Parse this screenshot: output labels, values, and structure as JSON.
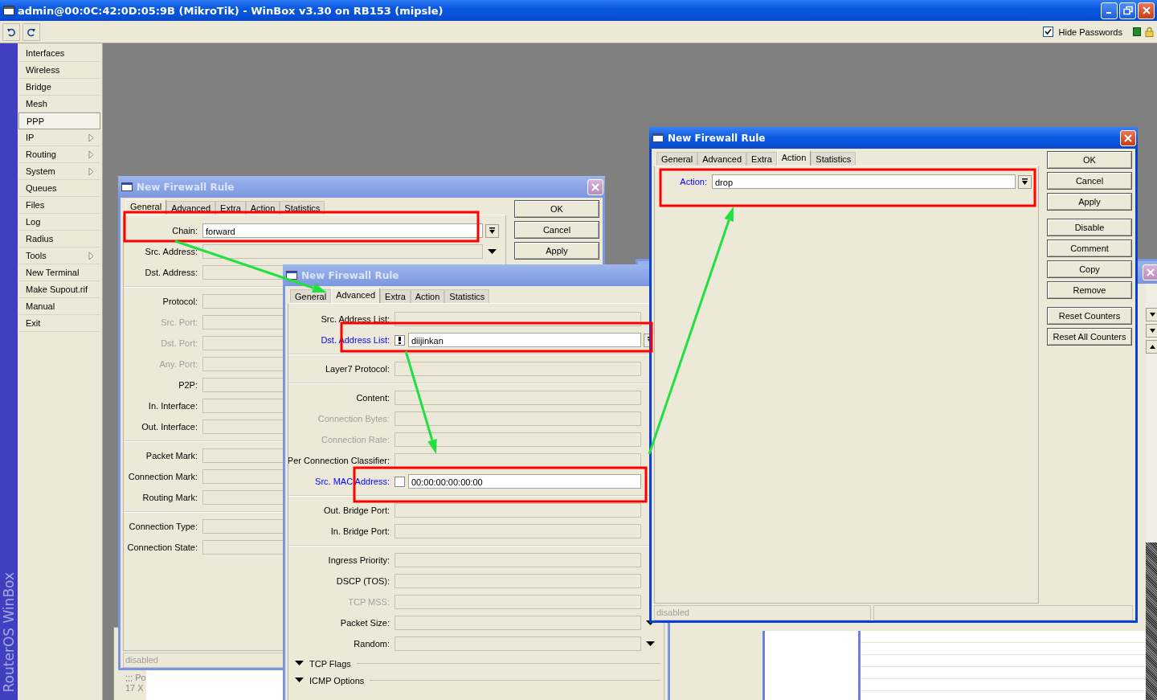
{
  "window": {
    "title": "admin@00:0C:42:0D:05:9B (MikroTik) - WinBox v3.30 on RB153 (mipsle)"
  },
  "toolbar": {
    "hide_passwords": {
      "label": "Hide Passwords",
      "checked": true
    }
  },
  "brand": "RouterOS WinBox",
  "sidebar": {
    "items": [
      {
        "label": "Interfaces",
        "selected": false,
        "submenu": false
      },
      {
        "label": "Wireless",
        "selected": false,
        "submenu": false
      },
      {
        "label": "Bridge",
        "selected": false,
        "submenu": false
      },
      {
        "label": "Mesh",
        "selected": false,
        "submenu": false
      },
      {
        "label": "PPP",
        "selected": true,
        "submenu": false
      },
      {
        "label": "IP",
        "selected": false,
        "submenu": true
      },
      {
        "label": "Routing",
        "selected": false,
        "submenu": true
      },
      {
        "label": "System",
        "selected": false,
        "submenu": true
      },
      {
        "label": "Queues",
        "selected": false,
        "submenu": false
      },
      {
        "label": "Files",
        "selected": false,
        "submenu": false
      },
      {
        "label": "Log",
        "selected": false,
        "submenu": false
      },
      {
        "label": "Radius",
        "selected": false,
        "submenu": false
      },
      {
        "label": "Tools",
        "selected": false,
        "submenu": true
      },
      {
        "label": "New Terminal",
        "selected": false,
        "submenu": false
      },
      {
        "label": "Make Supout.rif",
        "selected": false,
        "submenu": false
      },
      {
        "label": "Manual",
        "selected": false,
        "submenu": false
      },
      {
        "label": "Exit",
        "selected": false,
        "submenu": false
      }
    ]
  },
  "background_list": {
    "rows": [
      ";;; Po",
      "17 X"
    ]
  },
  "dialogs": [
    {
      "title": "New Firewall Rule",
      "active": false,
      "tabs": [
        {
          "label": "General",
          "selected": true
        },
        {
          "label": "Advanced",
          "selected": false
        },
        {
          "label": "Extra",
          "selected": false
        },
        {
          "label": "Action",
          "selected": false
        },
        {
          "label": "Statistics",
          "selected": false
        }
      ],
      "groups": [
        [
          {
            "label": "Chain:",
            "value": "forward",
            "dropdown": {
              "kind": "button"
            },
            "disabled": false,
            "emphasized": false
          },
          {
            "label": "Src. Address:",
            "dropdown": {
              "kind": "arrow"
            },
            "disabled": false,
            "emphasized": false
          },
          {
            "label": "Dst. Address:",
            "disabled": false,
            "emphasized": false
          }
        ],
        [
          {
            "label": "Protocol:",
            "disabled": false,
            "emphasized": false
          },
          {
            "label": "Src. Port:",
            "disabled": true,
            "emphasized": false
          },
          {
            "label": "Dst. Port:",
            "disabled": true,
            "emphasized": false
          },
          {
            "label": "Any. Port:",
            "disabled": true,
            "emphasized": false
          },
          {
            "label": "P2P:",
            "disabled": false,
            "emphasized": false
          },
          {
            "label": "In. Interface:",
            "disabled": false,
            "emphasized": false
          },
          {
            "label": "Out. Interface:",
            "disabled": false,
            "emphasized": false
          }
        ],
        [
          {
            "label": "Packet Mark:",
            "disabled": false,
            "emphasized": false
          },
          {
            "label": "Connection Mark:",
            "disabled": false,
            "emphasized": false
          },
          {
            "label": "Routing Mark:",
            "disabled": false,
            "emphasized": false
          }
        ],
        [
          {
            "label": "Connection Type:",
            "disabled": false,
            "emphasized": false
          },
          {
            "label": "Connection State:",
            "disabled": false,
            "emphasized": false
          }
        ]
      ],
      "button_groups": [
        [
          "OK",
          "Cancel",
          "Apply"
        ]
      ],
      "status": "disabled"
    },
    {
      "title": "New Firewall Rule",
      "active": false,
      "tabs": [
        {
          "label": "General",
          "selected": false
        },
        {
          "label": "Advanced",
          "selected": true
        },
        {
          "label": "Extra",
          "selected": false
        },
        {
          "label": "Action",
          "selected": false
        },
        {
          "label": "Statistics",
          "selected": false
        }
      ],
      "groups": [
        [
          {
            "label": "Src. Address List:",
            "disabled": false,
            "emphasized": false
          },
          {
            "label": "Dst. Address List:",
            "kind": "negatable",
            "negated": true,
            "value": "diijinkan",
            "dropdown": {
              "kind": "button"
            },
            "disabled": false,
            "emphasized": true
          }
        ],
        [
          {
            "label": "Layer7 Protocol:",
            "disabled": false,
            "emphasized": false
          }
        ],
        [
          {
            "label": "Content:",
            "disabled": false,
            "emphasized": false
          },
          {
            "label": "Connection Bytes:",
            "disabled": true,
            "emphasized": false
          },
          {
            "label": "Connection Rate:",
            "disabled": true,
            "emphasized": false
          },
          {
            "label": "Per Connection Classifier:",
            "disabled": false,
            "emphasized": false
          },
          {
            "label": "Src. MAC Address:",
            "kind": "negatable",
            "negated": false,
            "value": "00:00:00:00:00:00",
            "disabled": false,
            "emphasized": true
          }
        ],
        [
          {
            "label": "Out. Bridge Port:",
            "disabled": false,
            "emphasized": false
          },
          {
            "label": "In. Bridge Port:",
            "disabled": false,
            "emphasized": false
          }
        ],
        [
          {
            "label": "Ingress Priority:",
            "disabled": false,
            "emphasized": false
          },
          {
            "label": "DSCP (TOS):",
            "disabled": false,
            "emphasized": false
          },
          {
            "label": "TCP MSS:",
            "disabled": true,
            "emphasized": false
          },
          {
            "label": "Packet Size:",
            "dropdown": {
              "kind": "arrow"
            },
            "disabled": false,
            "emphasized": false
          },
          {
            "label": "Random:",
            "dropdown": {
              "kind": "arrow"
            },
            "disabled": false,
            "emphasized": false
          }
        ]
      ],
      "sections": [
        {
          "label": "TCP Flags"
        },
        {
          "label": "ICMP Options"
        }
      ]
    },
    {
      "title": "New Firewall Rule",
      "active": true,
      "tabs": [
        {
          "label": "General",
          "selected": false
        },
        {
          "label": "Advanced",
          "selected": false
        },
        {
          "label": "Extra",
          "selected": false
        },
        {
          "label": "Action",
          "selected": true
        },
        {
          "label": "Statistics",
          "selected": false
        }
      ],
      "groups": [
        [
          {
            "label": "Action:",
            "value": "drop",
            "dropdown": {
              "kind": "button"
            },
            "disabled": false,
            "emphasized": true
          }
        ]
      ],
      "button_groups": [
        [
          "OK",
          "Cancel",
          "Apply"
        ],
        [
          "Disable",
          "Comment",
          "Copy",
          "Remove"
        ],
        [
          "Reset Counters",
          "Reset All Counters"
        ]
      ],
      "status": "disabled"
    }
  ]
}
